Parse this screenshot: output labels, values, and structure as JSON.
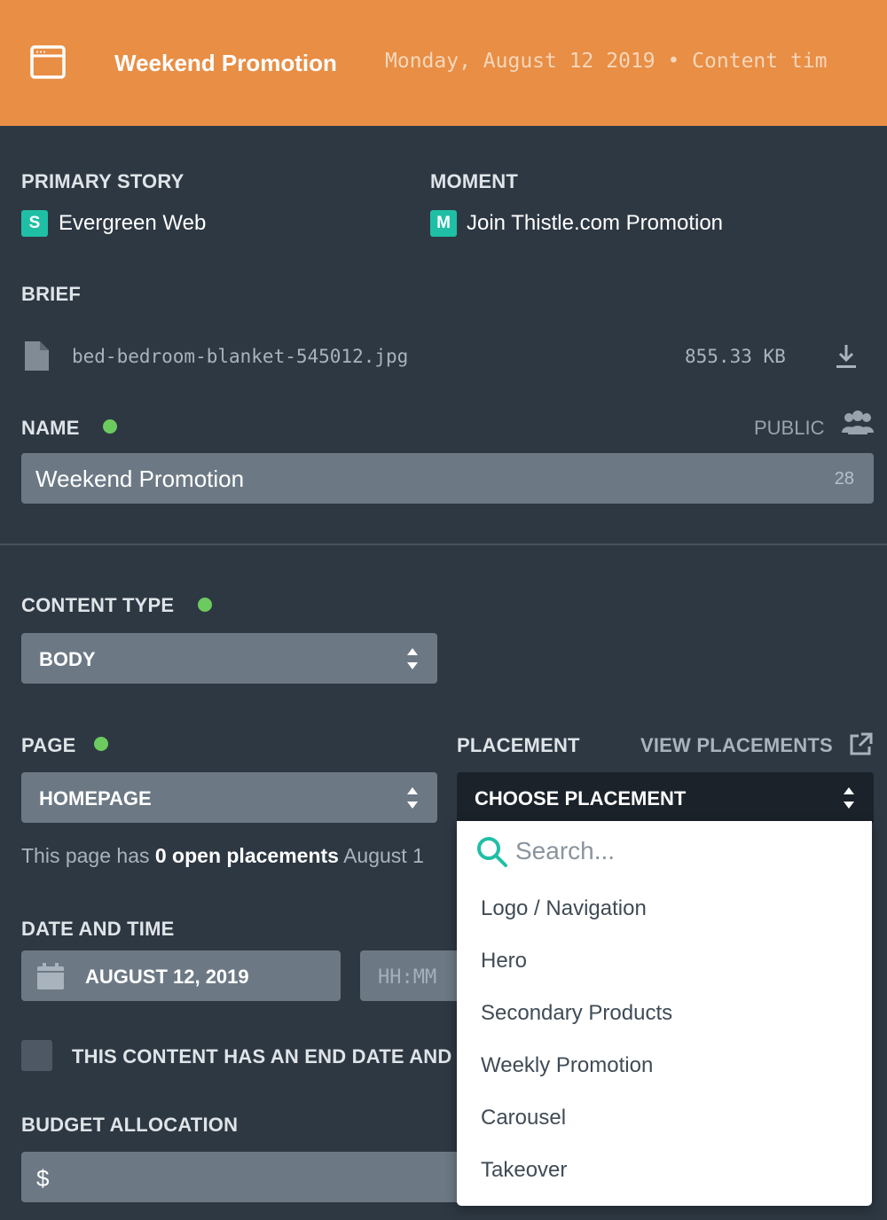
{
  "header": {
    "title": "Weekend Promotion",
    "subtitle": "Monday, August 12 2019 • Content tim",
    "icon": "browser-window-icon"
  },
  "primary_story": {
    "label": "PRIMARY STORY",
    "badge": "S",
    "name": "Evergreen Web"
  },
  "moment": {
    "label": "MOMENT",
    "badge": "M",
    "name": "Join Thistle.com Promotion"
  },
  "brief": {
    "label": "BRIEF",
    "filename": "bed-bedroom-blanket-545012.jpg",
    "size": "855.33 KB"
  },
  "name_section": {
    "label": "NAME",
    "visibility": "PUBLIC",
    "value": "Weekend Promotion",
    "char_count": "28"
  },
  "content_type": {
    "label": "CONTENT TYPE",
    "value": "BODY"
  },
  "page": {
    "label": "PAGE",
    "value": "HOMEPAGE",
    "info_prefix": "This page has ",
    "info_count": "0 open placements",
    "info_suffix": " August 1"
  },
  "placement": {
    "label": "PLACEMENT",
    "view_link": "VIEW PLACEMENTS",
    "value": "CHOOSE PLACEMENT",
    "search_placeholder": "Search...",
    "options": [
      "Logo / Navigation",
      "Hero",
      "Secondary Products",
      "Weekly Promotion",
      "Carousel",
      "Takeover"
    ]
  },
  "date_time": {
    "label": "DATE AND TIME",
    "date": "AUGUST 12, 2019",
    "time_placeholder": "HH:MM"
  },
  "end_date": {
    "label": "THIS CONTENT HAS AN END DATE AND TIME"
  },
  "budget": {
    "label": "BUDGET ALLOCATION",
    "currency": "$"
  },
  "colors": {
    "header": "#e88e45",
    "background": "#2e3843",
    "accent": "#1fbfa6",
    "status": "#6ccb5f"
  }
}
